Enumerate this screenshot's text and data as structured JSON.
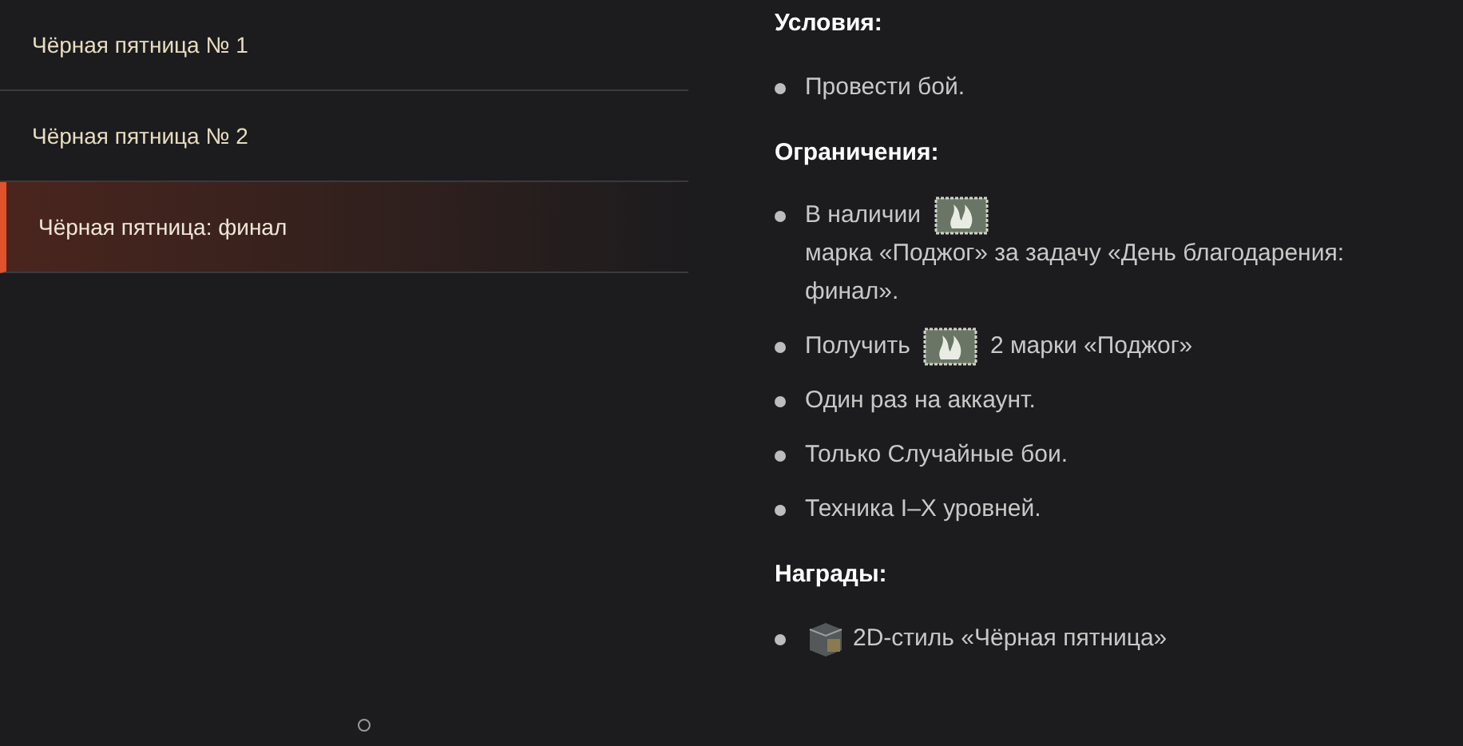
{
  "menu": [
    {
      "label": "Чёрная пятница № 1",
      "selected": false
    },
    {
      "label": "Чёрная пятница № 2",
      "selected": false
    },
    {
      "label": "Чёрная пятница: финал",
      "selected": true
    }
  ],
  "sections": [
    {
      "title": "Условия:",
      "items": [
        [
          {
            "kind": "text",
            "text": "Провести бой."
          }
        ]
      ]
    },
    {
      "title": "Ограничения:",
      "items": [
        [
          {
            "kind": "text",
            "text": "В наличии"
          },
          {
            "kind": "stamp"
          },
          {
            "kind": "text",
            "text": "марка «Поджог» за задачу «День благодарения: финал»."
          }
        ],
        [
          {
            "kind": "text",
            "text": "Получить"
          },
          {
            "kind": "stamp"
          },
          {
            "kind": "text",
            "text": "2 марки «Поджог»"
          }
        ],
        [
          {
            "kind": "text",
            "text": "Один раз на аккаунт."
          }
        ],
        [
          {
            "kind": "text",
            "text": "Только Случайные бои."
          }
        ],
        [
          {
            "kind": "text",
            "text": "Техника I–X уровней."
          }
        ]
      ]
    },
    {
      "title": "Награды:",
      "items": [
        [
          {
            "kind": "crate"
          },
          {
            "kind": "text",
            "text": "2D-стиль «Чёрная пятница»"
          }
        ]
      ]
    }
  ]
}
